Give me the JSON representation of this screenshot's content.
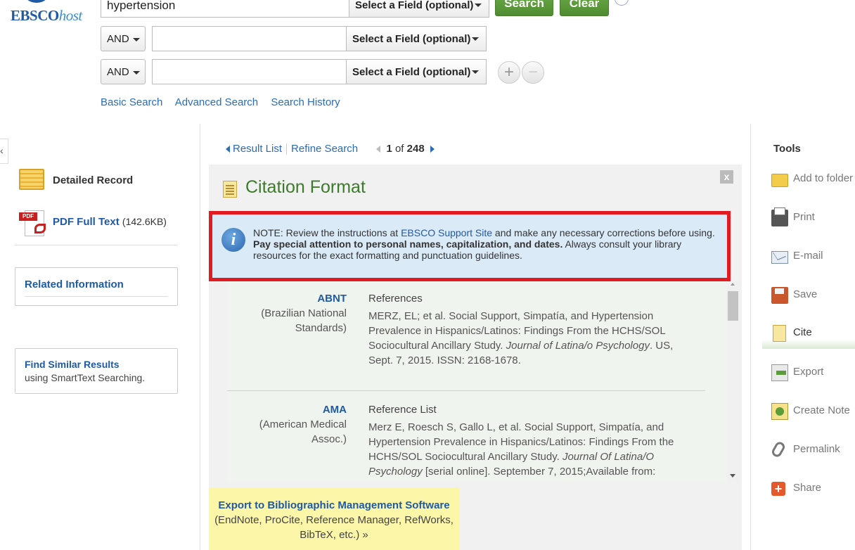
{
  "logo": {
    "main": "EBSCO",
    "suffix": "host"
  },
  "search": {
    "term1": "hypertension",
    "rows": [
      {
        "bool": "AND",
        "term": "",
        "field": "Select a Field (optional)"
      },
      {
        "bool": "AND",
        "term": "",
        "field": "Select a Field (optional)"
      }
    ],
    "field1": "Select a Field (optional)",
    "search_label": "Search",
    "clear_label": "Clear",
    "add_symbol": "+",
    "remove_symbol": "−",
    "links": [
      "Basic Search",
      "Advanced Search",
      "Search History"
    ]
  },
  "sidebar": {
    "collapse_symbol": "‹",
    "detailed_record": "Detailed Record",
    "pdf_badge": "PDF",
    "pdf_label": "PDF Full Text",
    "pdf_size": "(142.6KB)",
    "related_info": "Related Information",
    "find_similar_title": "Find Similar Results",
    "find_similar_sub": "using SmartText Searching."
  },
  "nav": {
    "result_list": "Result List",
    "refine_search": "Refine Search",
    "current": "1",
    "of": "of",
    "total": "248"
  },
  "citation": {
    "title": "Citation Format",
    "close_symbol": "x",
    "note_prefix": "NOTE: Review the instructions at ",
    "note_link": "EBSCO Support Site",
    "note_mid": " and make any necessary corrections before using. ",
    "note_bold": "Pay special attention to personal names, capitalization, and dates.",
    "note_end": " Always consult your library resources for the exact formatting and punctuation guidelines.",
    "records": [
      {
        "abbr": "ABNT",
        "full": "(Brazilian National Standards)",
        "heading": "References",
        "text_a": "MERZ, EL; et al. Social Support, Simpatía, and Hypertension Prevalence in Hispanics/Latinos: Findings From the HCHS/SOL Sociocultural Ancillary Study. ",
        "journal": "Journal of Latina/o Psychology",
        "text_b": ". US, Sept. 7, 2015. ISSN: 2168-1678."
      },
      {
        "abbr": "AMA",
        "full": "(American Medical Assoc.)",
        "heading": "Reference List",
        "text_a": "Merz E, Roesch S, Gallo L, et al. Social Support, Simpatía, and Hypertension Prevalence in Hispanics/Latinos: Findings From the HCHS/SOL Sociocultural Ancillary Study. ",
        "journal": "Journal Of Latina/O Psychology",
        "text_b": " [serial online]. September 7, 2015;Available from:"
      }
    ],
    "export_title": "Export to Bibliographic Management Software",
    "export_sub": "(EndNote, ProCite, Reference Manager, RefWorks, BibTeX, etc.) »"
  },
  "tools": {
    "title": "Tools",
    "items": [
      {
        "label": "Add to folder",
        "icon": "folder-icon"
      },
      {
        "label": "Print",
        "icon": "printer-icon"
      },
      {
        "label": "E-mail",
        "icon": "email-icon"
      },
      {
        "label": "Save",
        "icon": "save-icon"
      },
      {
        "label": "Cite",
        "icon": "cite-icon"
      },
      {
        "label": "Export",
        "icon": "export-icon"
      },
      {
        "label": "Create Note",
        "icon": "note-icon"
      },
      {
        "label": "Permalink",
        "icon": "link-icon"
      },
      {
        "label": "Share",
        "icon": "share-icon",
        "glyph": "+"
      }
    ],
    "active": "Cite"
  },
  "colors": {
    "link_blue": "#2a6cb8",
    "button_green": "#5d9a3c",
    "title_green": "#3d7a2c",
    "highlight_red": "#e21b22",
    "note_bg": "#dbeaf7",
    "export_bg": "#fcf6a8"
  }
}
